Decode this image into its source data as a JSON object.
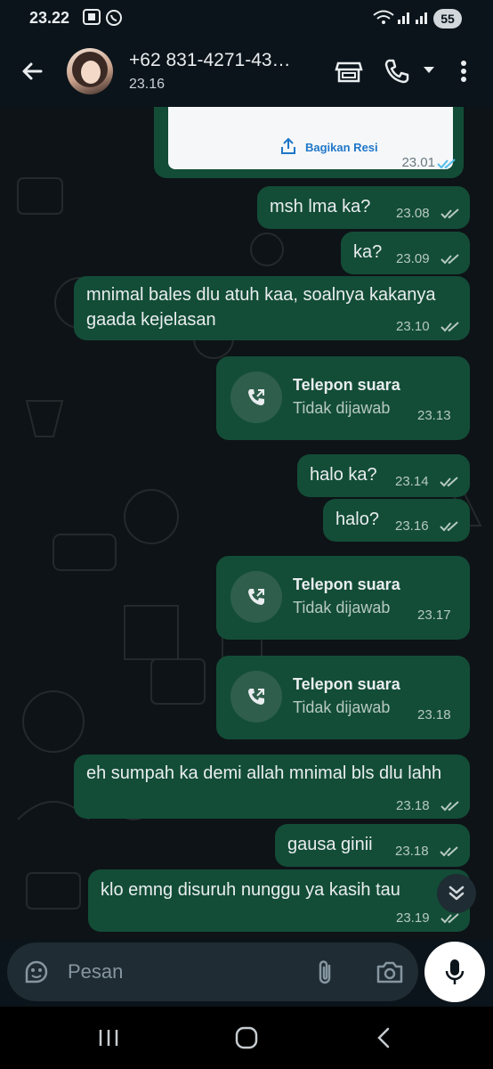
{
  "status_bar": {
    "time": "23.22",
    "battery": "55"
  },
  "header": {
    "contact_name": "+62 831-4271-43…",
    "last_seen": "23.16"
  },
  "receipt": {
    "share_label": "Bagikan Resi",
    "time": "23.01"
  },
  "messages": [
    {
      "text": "msh lma ka?",
      "time": "23.08"
    },
    {
      "text": "ka?",
      "time": "23.09"
    },
    {
      "text": "mnimal bales dlu atuh kaa, soalnya kakanya gaada kejelasan",
      "time": "23.10"
    },
    {
      "call_title": "Telepon suara",
      "call_status": "Tidak dijawab",
      "time": "23.13"
    },
    {
      "text": "halo ka?",
      "time": "23.14"
    },
    {
      "text": "halo?",
      "time": "23.16"
    },
    {
      "call_title": "Telepon suara",
      "call_status": "Tidak dijawab",
      "time": "23.17"
    },
    {
      "call_title": "Telepon suara",
      "call_status": "Tidak dijawab",
      "time": "23.18"
    },
    {
      "text": "eh sumpah ka demi allah mnimal bls dlu lahh",
      "time": "23.18"
    },
    {
      "text": "gausa ginii",
      "time": "23.18"
    },
    {
      "text": "klo emng disuruh nunggu ya kasih tau",
      "time": "23.19"
    }
  ],
  "composer": {
    "placeholder": "Pesan"
  },
  "colors": {
    "bubble": "#134d37",
    "background": "#0b141a",
    "accent": "#1f77c9"
  }
}
